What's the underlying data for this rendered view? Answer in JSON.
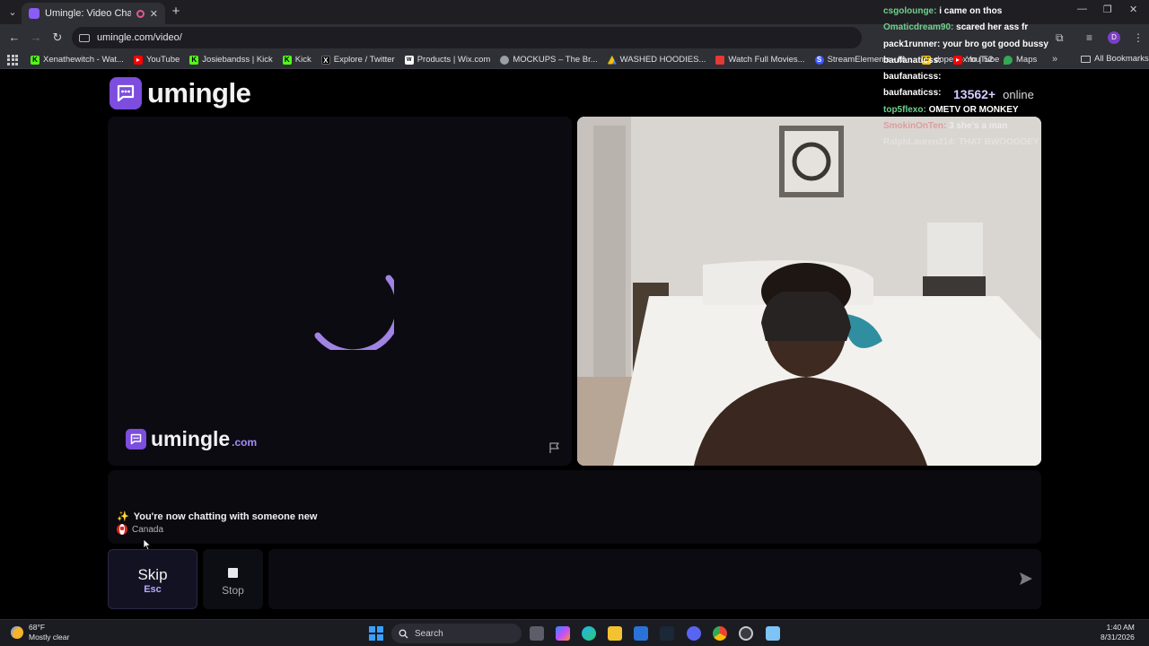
{
  "browser": {
    "tab_title": "Umingle: Video Chat with S",
    "url": "umingle.com/video/",
    "bookmarks": [
      {
        "label": "Xenathewitch - Wat...",
        "icon": "kick-icon",
        "color": "#53fc18"
      },
      {
        "label": "YouTube",
        "icon": "youtube-icon",
        "color": "#ff0000"
      },
      {
        "label": "Josiebandss | Kick",
        "icon": "kick-icon",
        "color": "#53fc18"
      },
      {
        "label": "Kick",
        "icon": "kick-icon",
        "color": "#53fc18"
      },
      {
        "label": "Explore / Twitter",
        "icon": "x-icon",
        "color": "#000000"
      },
      {
        "label": "Products | Wix.com",
        "icon": "wix-icon",
        "color": "#ffffff"
      },
      {
        "label": "MOCKUPS – The Br...",
        "icon": "globe-icon",
        "color": "#9aa0a6"
      },
      {
        "label": "WASHED HOODIES...",
        "icon": "drive-icon",
        "color": "#34a853"
      },
      {
        "label": "Watch Full Movies...",
        "icon": "movie-icon",
        "color": "#e53935"
      },
      {
        "label": "StreamElements - M...",
        "icon": "streamelements-icon",
        "color": "#3d5afe"
      },
      {
        "label": "dopebox.to | 52",
        "icon": "dopebox-icon",
        "color": "#f5c400"
      }
    ],
    "bookmarks_right": [
      {
        "label": "YouTube",
        "icon": "youtube-icon",
        "color": "#ff0000"
      },
      {
        "label": "Maps",
        "icon": "maps-icon",
        "color": "#34a853"
      }
    ],
    "all_bookmarks_label": "All Bookmarks"
  },
  "site": {
    "brand": "umingle",
    "brand_domain": ".com",
    "accent": "#7c4dde",
    "online_count": "13562+",
    "online_label": "online"
  },
  "stream_chat": [
    {
      "user": "csgolounge:",
      "text": "i came on thos",
      "user_color": "#ffffff"
    },
    {
      "user": "Omaticdream90:",
      "text": "scared her ass fr",
      "user_color": "#6fd08c"
    },
    {
      "user": "pack1runner:",
      "text": "your bro got good bussy",
      "user_color": "#ffffff"
    },
    {
      "user": "baufanaticss:",
      "text": "",
      "user_color": "#ffffff"
    },
    {
      "user": "baufanaticss:",
      "text": "",
      "user_color": "#ffffff"
    },
    {
      "user": "baufanaticss:",
      "text": "",
      "user_color": "#ffffff"
    },
    {
      "user": "top5flexo:",
      "text": "OMETV OR MONKEY",
      "user_color": "#6fd08c"
    },
    {
      "user": "SmokinOnTen:",
      "text": "3 she's a man",
      "user_color": "#e0707a"
    },
    {
      "user": "RalphLauren214:",
      "text": "THAT BWOOOOEY",
      "user_color": "#ffffff"
    }
  ],
  "chat": {
    "status_icon": "sparkles-icon",
    "status": "You're now chatting with someone new",
    "country": "Canada",
    "message_placeholder": ""
  },
  "controls": {
    "skip_label": "Skip",
    "skip_key": "Esc",
    "stop_label": "Stop"
  },
  "taskbar": {
    "temperature": "68°F",
    "weather": "Mostly clear",
    "search_placeholder": "Search",
    "time": "1:40 AM",
    "date": "8/31/2026"
  }
}
